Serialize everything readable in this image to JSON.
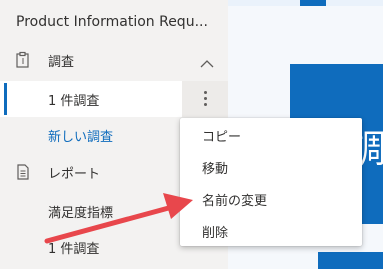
{
  "app": {
    "title": "Product Information Requ..."
  },
  "sidebar": {
    "section_survey": {
      "label": "調査",
      "icon": "clipboard-icon",
      "expanded": true
    },
    "items": [
      {
        "label": "1 件調査",
        "selected": true
      },
      {
        "label": "新しい調査",
        "link": true
      }
    ],
    "section_report": {
      "label": "レポート",
      "icon": "document-icon"
    },
    "report_items": [
      {
        "label": "満足度指標"
      },
      {
        "label": "1 件調査"
      }
    ]
  },
  "context_menu": {
    "items": [
      {
        "label": "コピー"
      },
      {
        "label": "移動"
      },
      {
        "label": "名前の変更"
      },
      {
        "label": "削除"
      }
    ]
  },
  "content": {
    "card_text": "調査"
  },
  "colors": {
    "accent": "#0f6cbd",
    "sidebar_bg": "#f3f2f1",
    "arrow": "#e8474c"
  }
}
